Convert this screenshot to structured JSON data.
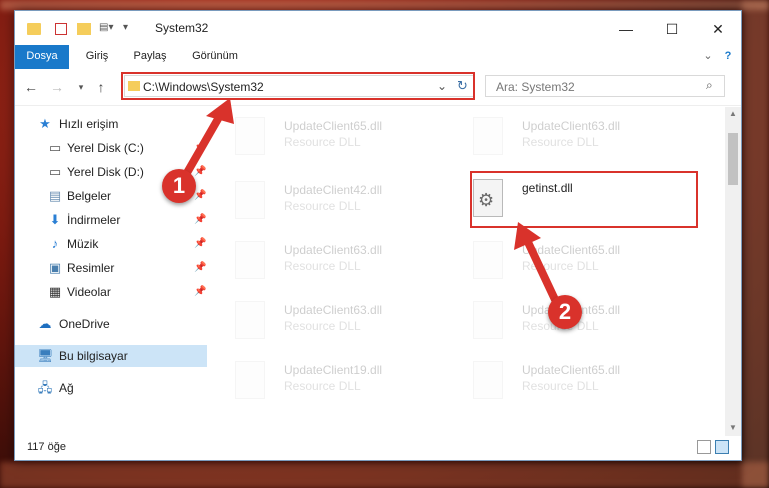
{
  "window": {
    "title": "System32",
    "controls": {
      "minimize": "—",
      "maximize": "☐",
      "close": "✕"
    }
  },
  "ribbon": {
    "tabs": [
      {
        "label": "Dosya"
      },
      {
        "label": "Giriş"
      },
      {
        "label": "Paylaş"
      },
      {
        "label": "Görünüm"
      }
    ]
  },
  "nav": {
    "address": "C:\\Windows\\System32",
    "search_placeholder": "Ara: System32"
  },
  "sidebar": {
    "items": [
      {
        "label": "Hızlı erişim",
        "icon": "star-icon"
      },
      {
        "label": "Yerel Disk (C:)",
        "icon": "drive-icon"
      },
      {
        "label": "Yerel Disk (D:)",
        "icon": "drive-icon"
      },
      {
        "label": "Belgeler",
        "icon": "documents-icon"
      },
      {
        "label": "İndirmeler",
        "icon": "download-icon"
      },
      {
        "label": "Müzik",
        "icon": "music-icon"
      },
      {
        "label": "Resimler",
        "icon": "pictures-icon"
      },
      {
        "label": "Videolar",
        "icon": "video-icon"
      },
      {
        "label": "OneDrive",
        "icon": "cloud-icon"
      },
      {
        "label": "Bu bilgisayar",
        "icon": "computer-icon"
      },
      {
        "label": "Ağ",
        "icon": "network-icon"
      }
    ]
  },
  "files": [
    {
      "name": "UpdateClient65.dll",
      "type": "Resource DLL"
    },
    {
      "name": "UpdateClient63.dll",
      "type": "Resource DLL"
    },
    {
      "name": "UpdateClient42.dll",
      "type": "Resource DLL"
    },
    {
      "name": "getinst.dll",
      "type": ""
    },
    {
      "name": "UpdateClient63.dll",
      "type": "Resource DLL"
    },
    {
      "name": "UpdateClient65.dll",
      "type": "Resource DLL"
    },
    {
      "name": "UpdateClient63.dll",
      "type": "Resource DLL"
    },
    {
      "name": "UpdateClient65.dll",
      "type": "Resource DLL"
    },
    {
      "name": "UpdateClient19.dll",
      "type": "Resource DLL"
    },
    {
      "name": "UpdateClient65.dll",
      "type": "Resource DLL"
    }
  ],
  "status": {
    "count": "117 öğe"
  },
  "annotations": {
    "badge1": "1",
    "badge2": "2",
    "color": "#d9322b"
  }
}
